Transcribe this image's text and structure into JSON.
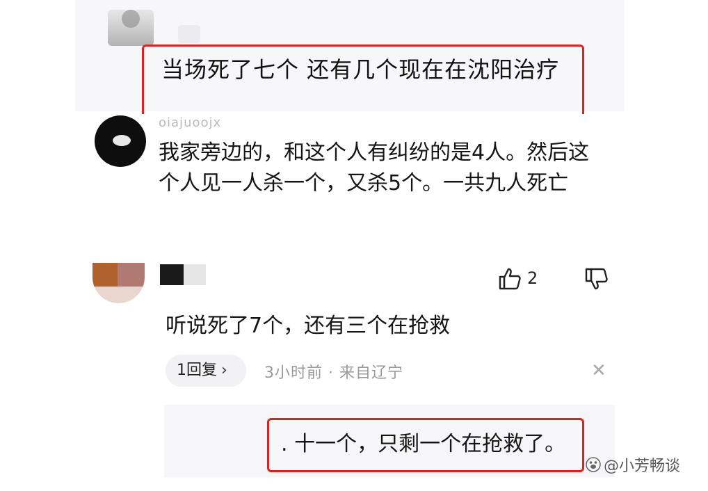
{
  "comment_1": {
    "text": "当场死了七个  还有几个现在在沈阳治疗"
  },
  "comment_2": {
    "username": "oiajuoojx",
    "text": "我家旁边的，和这个人有纠纷的是4人。然后这个人见一人杀一个，又杀5个。一共九人死亡"
  },
  "comment_3": {
    "like_count": "2",
    "text": "听说死了7个，还有三个在抢救",
    "reply_label": "1回复",
    "reply_chevron": "›",
    "meta": "3小时前 · 来自辽宁",
    "icons": [
      "thumbs-up-icon",
      "thumbs-down-icon",
      "close-icon",
      "chevron-right-icon"
    ]
  },
  "reply": {
    "text": ". 十一个，只剩一个在抢救了。"
  },
  "watermark": {
    "text": "@小芳畅谈"
  },
  "colors": {
    "highlight_border": "#e02020",
    "meta_text": "#9a9a9a",
    "pill_bg": "#f2f2f4"
  }
}
